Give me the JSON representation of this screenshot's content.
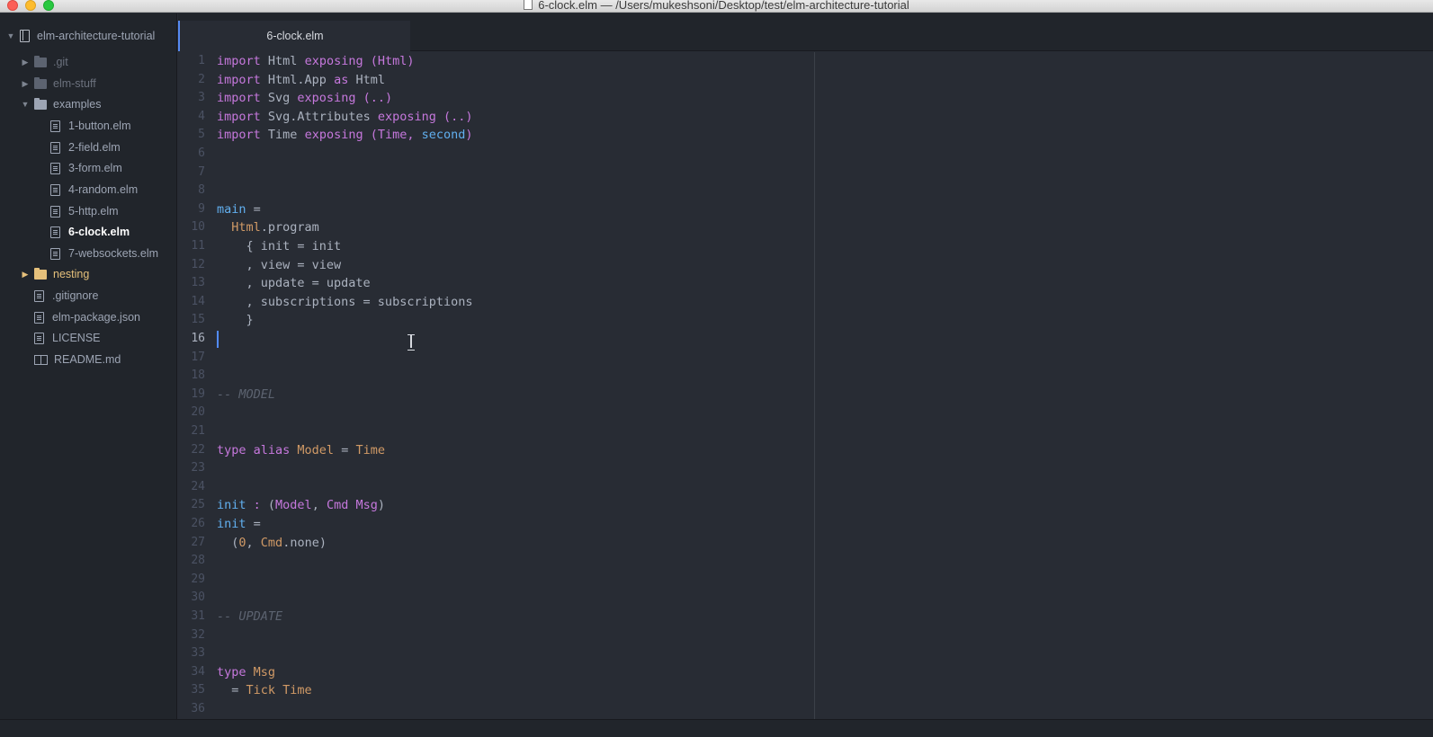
{
  "window": {
    "title": "6-clock.elm — /Users/mukeshsoni/Desktop/test/elm-architecture-tutorial"
  },
  "tree": {
    "root": "elm-architecture-tutorial",
    "items": [
      {
        "label": ".git"
      },
      {
        "label": "elm-stuff"
      },
      {
        "label": "examples"
      },
      {
        "label": "1-button.elm"
      },
      {
        "label": "2-field.elm"
      },
      {
        "label": "3-form.elm"
      },
      {
        "label": "4-random.elm"
      },
      {
        "label": "5-http.elm"
      },
      {
        "label": "6-clock.elm"
      },
      {
        "label": "7-websockets.elm"
      },
      {
        "label": "nesting"
      },
      {
        "label": ".gitignore"
      },
      {
        "label": "elm-package.json"
      },
      {
        "label": "LICENSE"
      },
      {
        "label": "README.md"
      }
    ]
  },
  "tabs": [
    {
      "label": "6-clock.elm"
    }
  ],
  "editor": {
    "line_numbers": [
      "1",
      "2",
      "3",
      "4",
      "5",
      "6",
      "7",
      "8",
      "9",
      "10",
      "11",
      "12",
      "13",
      "14",
      "15",
      "16",
      "17",
      "18",
      "19",
      "20",
      "21",
      "22",
      "23",
      "24",
      "25",
      "26",
      "27",
      "28",
      "29",
      "30",
      "31",
      "32",
      "33",
      "34",
      "35",
      "36"
    ],
    "current_line": "16",
    "code": {
      "l1": {
        "a": "import",
        "b": " Html ",
        "c": "exposing",
        "d": " (",
        "e": "Html",
        "f": ")"
      },
      "l2": {
        "a": "import",
        "b": " Html.App ",
        "c": "as",
        "d": " Html"
      },
      "l3": {
        "a": "import",
        "b": " Svg ",
        "c": "exposing",
        "d": " (..)"
      },
      "l4": {
        "a": "import",
        "b": " Svg.Attributes ",
        "c": "exposing",
        "d": " (..)"
      },
      "l5": {
        "a": "import",
        "b": " Time ",
        "c": "exposing",
        "d": " (",
        "e": "Time",
        "f": ", ",
        "g": "second",
        "h": ")"
      },
      "l9": {
        "a": "main",
        "b": " ="
      },
      "l10": {
        "a": "  ",
        "b": "Html",
        "c": ".program"
      },
      "l11": {
        "a": "    { init = init"
      },
      "l12": {
        "a": "    , view = view"
      },
      "l13": {
        "a": "    , update = update"
      },
      "l14": {
        "a": "    , subscriptions = subscriptions"
      },
      "l15": {
        "a": "    }"
      },
      "l19": {
        "a": "-- MODEL"
      },
      "l22": {
        "a": "type alias",
        "b": " ",
        "c": "Model",
        "d": " = ",
        "e": "Time"
      },
      "l25": {
        "a": "init",
        "b": " : ",
        "c": "(",
        "d": "Model",
        "e": ", ",
        "f": "Cmd Msg",
        "g": ")"
      },
      "l26": {
        "a": "init",
        "b": " ="
      },
      "l27": {
        "a": "  (",
        "b": "0",
        "c": ", ",
        "d": "Cmd",
        "e": ".none)"
      },
      "l31": {
        "a": "-- UPDATE"
      },
      "l34": {
        "a": "type",
        "b": " ",
        "c": "Msg"
      },
      "l35": {
        "a": "  = ",
        "b": "Tick Time"
      }
    }
  },
  "colors": {
    "background": "#282c34",
    "keyword": "#c678dd",
    "function": "#61afef",
    "type": "#e5c07b",
    "comment": "#5c6370",
    "accent": "#568af2"
  }
}
